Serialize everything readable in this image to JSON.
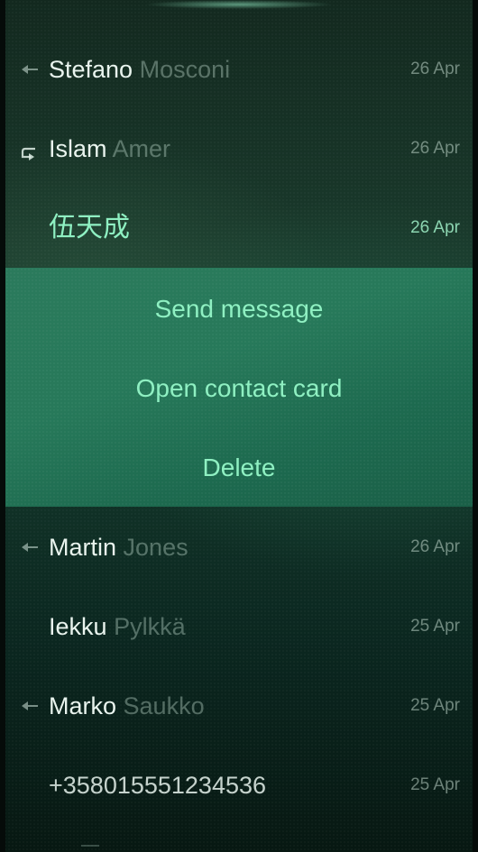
{
  "conversations": [
    {
      "first": "Stefano",
      "last": "Mosconi",
      "date": "26 Apr",
      "icon": "arrow-left-icon"
    },
    {
      "first": "Islam",
      "last": "Amer",
      "date": "26 Apr",
      "icon": "reply-arrow-icon"
    },
    {
      "first": "伍天成",
      "last": "",
      "date": "26 Apr",
      "icon": ""
    },
    {
      "first": "Martin",
      "last": "Jones",
      "date": "26 Apr",
      "icon": "arrow-left-icon"
    },
    {
      "first": "Iekku",
      "last": "Pylkkä",
      "date": "25 Apr",
      "icon": ""
    },
    {
      "first": "Marko",
      "last": "Saukko",
      "date": "25 Apr",
      "icon": "arrow-left-icon"
    },
    {
      "first": "+358015551234536",
      "last": "",
      "date": "25 Apr",
      "icon": ""
    }
  ],
  "context_menu": {
    "items": [
      "Send message",
      "Open contact card",
      "Delete"
    ]
  },
  "colors": {
    "highlight": "#8ff0c2",
    "menu_bg": "#267558",
    "background": "#0a1c16"
  }
}
